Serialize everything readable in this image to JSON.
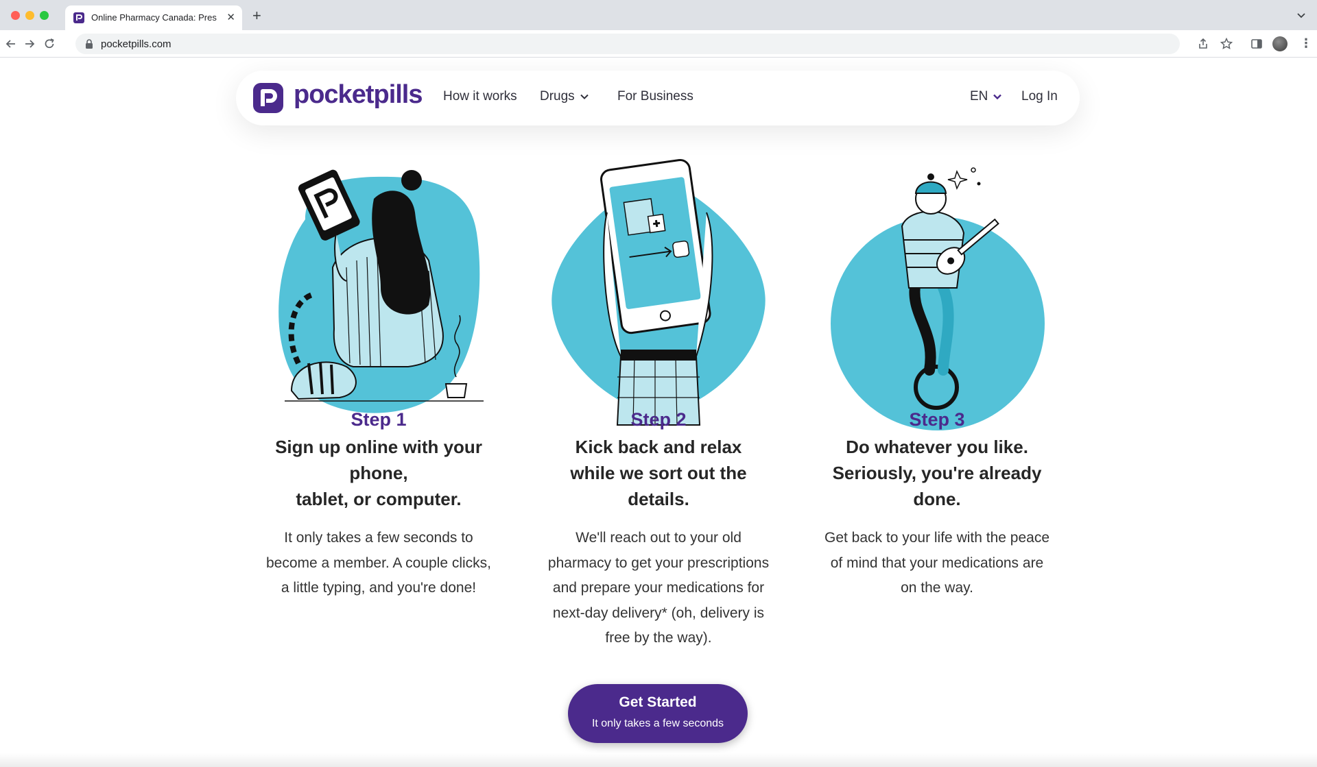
{
  "browser": {
    "tab_title": "Online Pharmacy Canada: Pres",
    "url": "pocketpills.com"
  },
  "header": {
    "logo_text": "pocketpills",
    "nav": {
      "how_it_works": "How it works",
      "drugs": "Drugs",
      "for_business": "For Business",
      "language": "EN",
      "login": "Log In"
    }
  },
  "steps": [
    {
      "label": "Step 1",
      "title_lines": [
        "Sign up online with your",
        "phone,",
        "tablet, or computer."
      ],
      "body_lines": [
        "It only takes a few seconds to",
        "become a member. A couple clicks,",
        "a little typing, and you're done!"
      ]
    },
    {
      "label": "Step 2",
      "title_lines": [
        "Kick back and relax",
        "while we sort out the",
        "details."
      ],
      "body_lines": [
        "We'll reach out to your old",
        "pharmacy to get your prescriptions",
        "and prepare your medications for",
        "next-day delivery* (oh, delivery is",
        "free by the way)."
      ]
    },
    {
      "label": "Step 3",
      "title_lines": [
        "Do whatever you like.",
        "Seriously, you're already",
        "done."
      ],
      "body_lines": [
        "Get back to your life with the peace",
        "of mind that your medications are",
        "on the way."
      ]
    }
  ],
  "cta": {
    "label": "Get Started",
    "sublabel": "It only takes a few seconds"
  },
  "colors": {
    "brand_purple": "#4b2a8c",
    "illustration_blue": "#54c2d8"
  }
}
